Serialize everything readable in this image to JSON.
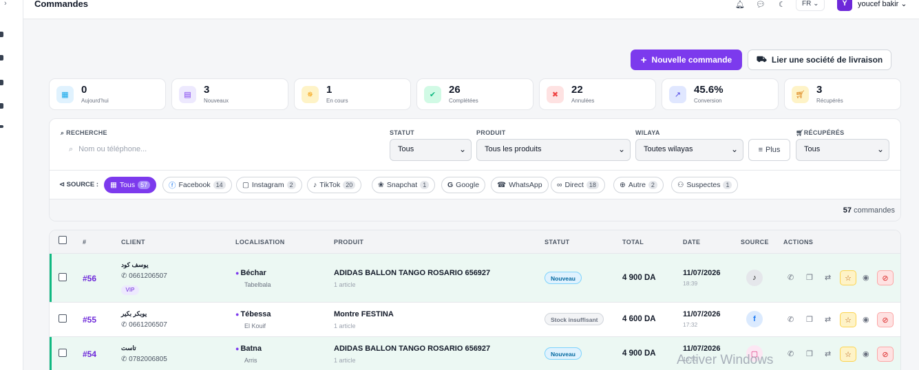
{
  "header": {
    "title": "Commandes",
    "lang": "FR",
    "user_initial": "Y",
    "user_name": "youcef bakir"
  },
  "actions": {
    "new_order": "Nouvelle commande",
    "link_delivery": "Lier une société de livraison"
  },
  "stats": [
    {
      "value": "0",
      "label": "Aujourd'hui",
      "icon": "calendar-icon",
      "color": "#0ea5e9"
    },
    {
      "value": "3",
      "label": "Nouveaux",
      "icon": "inbox-icon",
      "color": "#7c3aed"
    },
    {
      "value": "1",
      "label": "En cours",
      "icon": "spinner-icon",
      "color": "#f59e0b"
    },
    {
      "value": "26",
      "label": "Complétées",
      "icon": "check-circle-icon",
      "color": "#10b981"
    },
    {
      "value": "22",
      "label": "Annulées",
      "icon": "x-circle-icon",
      "color": "#ef4444"
    },
    {
      "value": "45.6%",
      "label": "Conversion",
      "icon": "trend-icon",
      "color": "#4f46e5"
    },
    {
      "value": "3",
      "label": "Récupérés",
      "icon": "cart-icon",
      "color": "#d97706"
    }
  ],
  "filters": {
    "search_label": "RECHERCHE",
    "search_placeholder": "Nom ou téléphone...",
    "statut_label": "STATUT",
    "statut_value": "Tous",
    "produit_label": "PRODUIT",
    "produit_value": "Tous les produits",
    "wilaya_label": "WILAYA",
    "wilaya_value": "Toutes wilayas",
    "plus_label": "Plus",
    "recuperes_label": "RÉCUPÉRÉS",
    "recuperes_value": "Tous",
    "source_label": "SOURCE :",
    "sources": [
      {
        "label": "Tous",
        "count": "57"
      },
      {
        "label": "Facebook",
        "count": "14"
      },
      {
        "label": "Instagram",
        "count": "2"
      },
      {
        "label": "TikTok",
        "count": "20"
      },
      {
        "label": "Snapchat",
        "count": "1"
      },
      {
        "label": "Google",
        "count": ""
      },
      {
        "label": "WhatsApp",
        "count": ""
      },
      {
        "label": "Direct",
        "count": "18"
      },
      {
        "label": "Autre",
        "count": "2"
      },
      {
        "label": "Suspectes",
        "count": "1"
      }
    ],
    "total_count": "57",
    "total_suffix": "commandes"
  },
  "table": {
    "headers": [
      "#",
      "CLIENT",
      "LOCALISATION",
      "PRODUIT",
      "STATUT",
      "TOTAL",
      "DATE",
      "SOURCE",
      "ACTIONS"
    ],
    "rows": [
      {
        "id": "#56",
        "client": "يوسف كود",
        "phone": "0661206507",
        "vip": "VIP",
        "city": "Béchar",
        "town": "Tabelbala",
        "product": "ADIDAS BALLON TANGO ROSARIO 656927",
        "articles": "1 article",
        "status": "Nouveau",
        "total": "4 900 DA",
        "date": "11/07/2026",
        "time": "18:39",
        "source": "tiktok-icon"
      },
      {
        "id": "#55",
        "client": "يوبكر بكير",
        "phone": "0661206507",
        "vip": "",
        "city": "Tébessa",
        "town": "El Kouif",
        "product": "Montre FESTINA",
        "articles": "1 article",
        "status": "Stock insuffisant",
        "total": "4 600 DA",
        "date": "11/07/2026",
        "time": "17:32",
        "source": "facebook-icon"
      },
      {
        "id": "#54",
        "client": "تاست",
        "phone": "0782006805",
        "vip": "",
        "city": "Batna",
        "town": "Arris",
        "product": "ADIDAS BALLON TANGO ROSARIO 656927",
        "articles": "1 article",
        "status": "Nouveau",
        "total": "4 900 DA",
        "date": "11/07/2026",
        "time": "16:50",
        "source": "instagram-icon"
      }
    ]
  },
  "watermark": "Activer Windows"
}
